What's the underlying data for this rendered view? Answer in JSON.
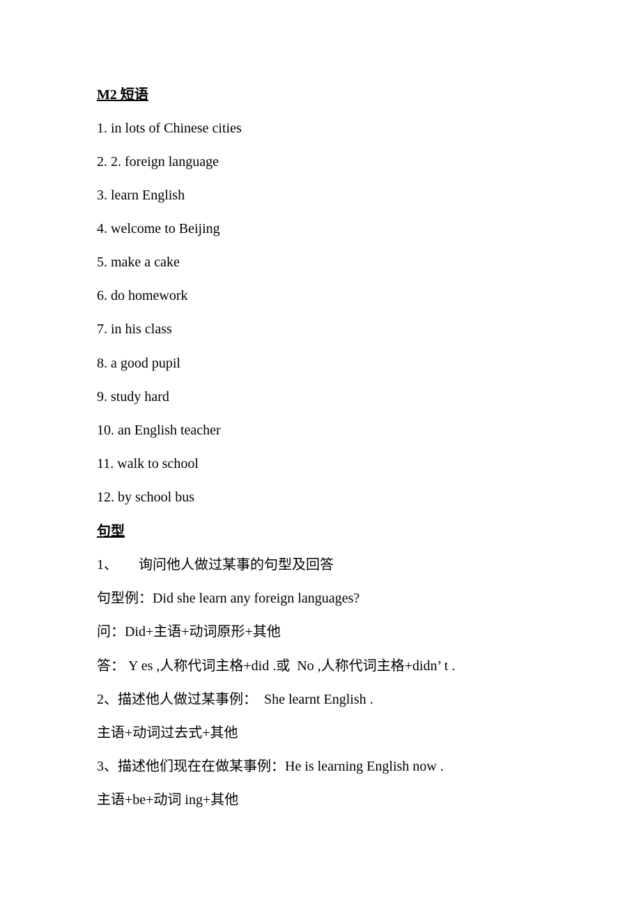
{
  "heading": "M2 短语",
  "phrases": [
    "1. in lots of Chinese cities",
    "2. 2. foreign language",
    "3. learn English",
    "4. welcome to Beijing",
    "5. make a cake",
    "6. do homework",
    "7. in his class",
    "8. a good pupil",
    "9. study hard",
    "10. an English teacher",
    "11. walk to school",
    "12. by school bus"
  ],
  "sentence_heading": "句型",
  "sentences": [
    "1、      询问他人做过某事的句型及回答",
    "句型例：Did she learn any foreign languages?",
    "问：Did+主语+动词原形+其他",
    "答： Y es ,人称代词主格+did .或  No ,人称代词主格+didn’ t .",
    "2、描述他人做过某事例：  She learnt English .",
    "主语+动词过去式+其他",
    "3、描述他们现在在做某事例：He is learning English now .",
    "主语+be+动词 ing+其他"
  ]
}
